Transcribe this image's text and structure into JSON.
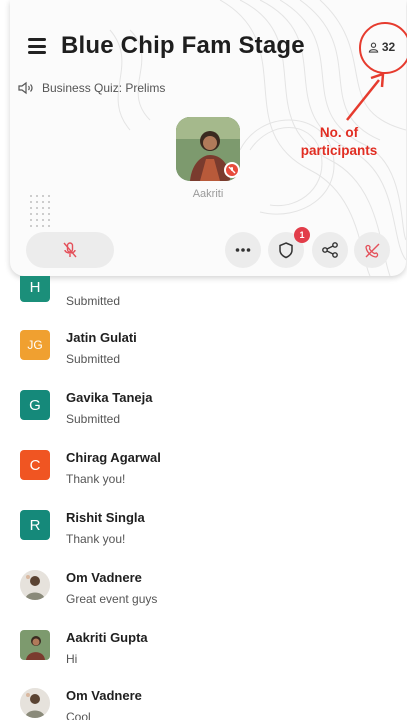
{
  "header": {
    "title": "Blue Chip Fam Stage",
    "participant_count": "32"
  },
  "annotation": {
    "line1": "No. of",
    "line2": "participants",
    "color": "#e12d22"
  },
  "stage": {
    "subtitle": "Business Quiz: Prelims",
    "speaker_name": "Aakriti"
  },
  "controls": {
    "mic": "mic-off-icon",
    "more": "more-dots-icon",
    "shield": "shield-icon",
    "shield_badge": "1",
    "share": "share-icon",
    "hangup": "hang-up-icon"
  },
  "messages": [
    {
      "name": "",
      "text": "Submitted",
      "initial": "H",
      "color": "#1b8f7a"
    },
    {
      "name": "Jatin Gulati",
      "text": "Submitted",
      "initial": "JG",
      "color": "#f0a030"
    },
    {
      "name": "Gavika Taneja",
      "text": "Submitted",
      "initial": "G",
      "color": "#15897a"
    },
    {
      "name": "Chirag Agarwal",
      "text": "Thank you!",
      "initial": "C",
      "color": "#f05522"
    },
    {
      "name": "Rishit Singla",
      "text": "Thank you!",
      "initial": "R",
      "color": "#15897a"
    },
    {
      "name": "Om Vadnere",
      "text": "Great event guys",
      "initial": "",
      "color": "#dddddd"
    },
    {
      "name": "Aakriti Gupta",
      "text": "Hi",
      "initial": "",
      "color": "#6a8a6a"
    },
    {
      "name": "Om Vadnere",
      "text": "Cool",
      "initial": "",
      "color": "#dddddd"
    }
  ]
}
